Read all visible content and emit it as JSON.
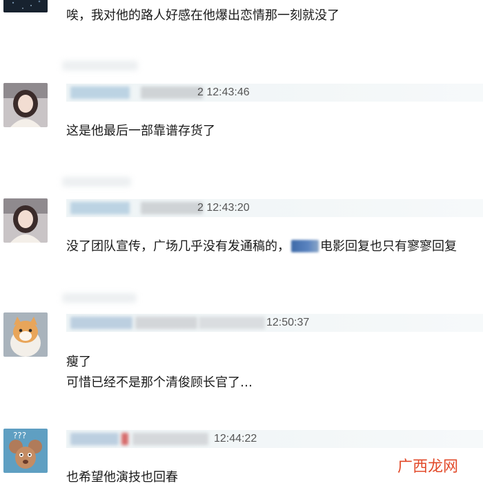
{
  "comments": [
    {
      "avatar_icon": "dark-avatar-image",
      "timestamp": "",
      "lines": [
        "唉，我对他的路人好感在他爆出恋情那一刻就没了"
      ]
    },
    {
      "avatar_icon": "girl-avatar-image",
      "timestamp": "2 12:43:46",
      "lines": [
        "这是他最后一部靠谱存货了"
      ]
    },
    {
      "avatar_icon": "girl-avatar-image",
      "timestamp": "2 12:43:20",
      "line_before": "没了团队宣传，广场几乎没有发通稿的，",
      "line_after": "电影回复也只有寥寥回复"
    },
    {
      "avatar_icon": "cat-avatar-image",
      "timestamp": "12:50:37",
      "lines": [
        "瘦了",
        "可惜已经不是那个清俊顾长官了…"
      ]
    },
    {
      "avatar_icon": "cartoon-mouse-avatar-image",
      "timestamp": "12:44:22",
      "lines": [
        "也希望他演技也回春"
      ]
    }
  ],
  "watermark": "广西龙网",
  "colors": {
    "meta_bar": "#eef4f6",
    "watermark": "#e24a2a",
    "text": "#1a1a1a"
  }
}
